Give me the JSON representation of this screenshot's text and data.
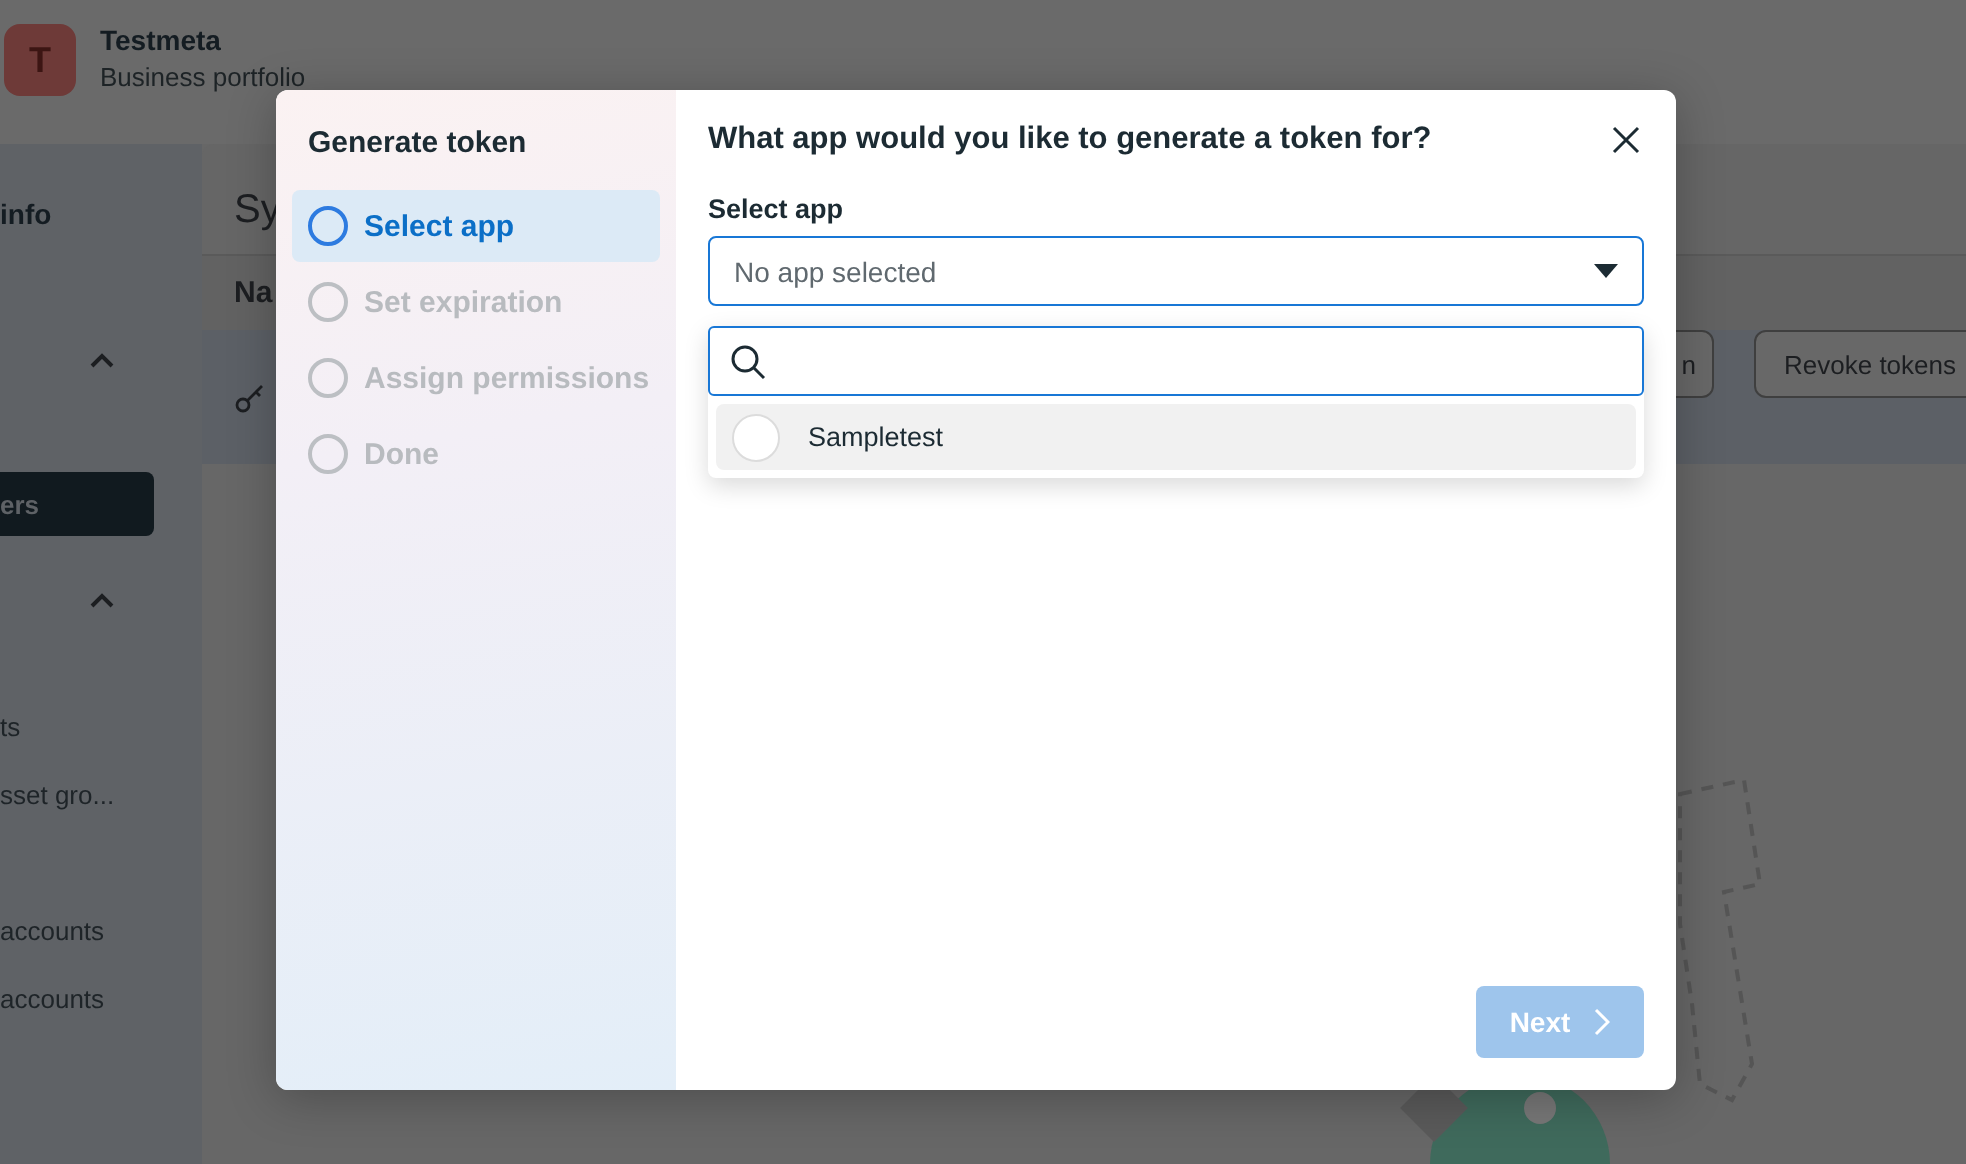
{
  "business": {
    "avatar": "T",
    "name": "Testmeta",
    "subtitle": "Business portfolio"
  },
  "sidebar": {
    "items": [
      {
        "kind": "heading",
        "label": "info"
      },
      {
        "kind": "section",
        "expanded": true
      },
      {
        "kind": "item",
        "label": "ers",
        "selected": true
      },
      {
        "kind": "section",
        "expanded": true
      },
      {
        "kind": "item",
        "label": "ts",
        "selected": false
      },
      {
        "kind": "item",
        "label": "sset gro...",
        "selected": false
      },
      {
        "kind": "item",
        "label": "accounts",
        "selected": false
      },
      {
        "kind": "item",
        "label": "accounts",
        "selected": false
      }
    ]
  },
  "page": {
    "heading": "Sy",
    "column_1": "Na",
    "buttons": [
      "n",
      "Revoke tokens"
    ]
  },
  "dialog": {
    "steps_title": "Generate token",
    "steps": [
      {
        "label": "Select app",
        "selected": true
      },
      {
        "label": "Set expiration",
        "selected": false
      },
      {
        "label": "Assign permissions",
        "selected": false
      },
      {
        "label": "Done",
        "selected": false
      }
    ],
    "title": "What app would you like to generate a token for?",
    "field_label": "Select app",
    "select": {
      "placeholder": "No app selected",
      "expanded": true
    },
    "options": [
      {
        "label": "Sampletest",
        "selected": false
      }
    ],
    "next_button": {
      "label": "Next",
      "disabled": true
    }
  }
}
